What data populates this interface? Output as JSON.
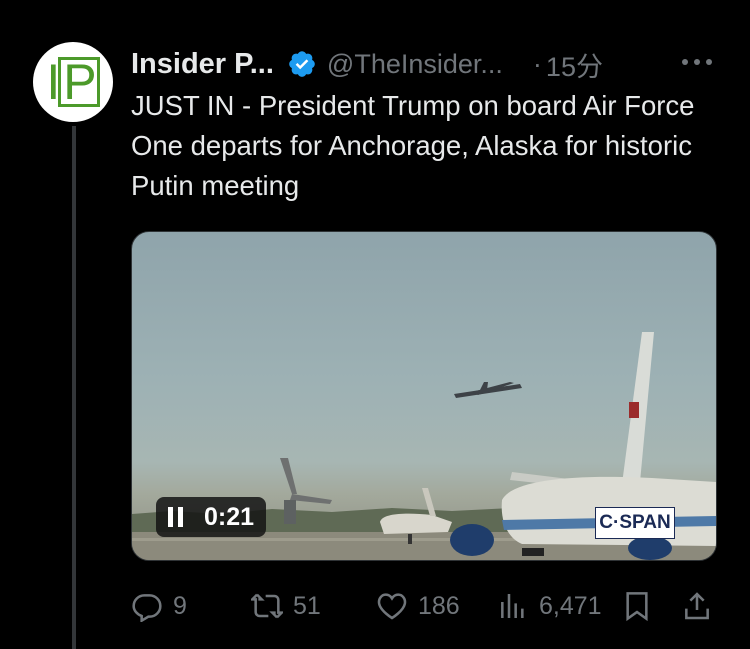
{
  "tweet": {
    "author_name": "Insider P...",
    "handle": "@TheInsider...",
    "separator": "·",
    "time": "15分",
    "text": "JUST IN - President Trump on board Air Force One departs for Anchorage, Alaska for historic Putin meeting",
    "avatar_text": "IP"
  },
  "media": {
    "duration": "0:21",
    "watermark": "C·SPAN"
  },
  "actions": {
    "replies": "9",
    "retweets": "51",
    "likes": "186",
    "views": "6,471"
  },
  "colors": {
    "background": "#000000",
    "text": "#e7e9ea",
    "muted": "#71767b",
    "verified": "#1d9bf0",
    "avatar_green": "#4c9a2a"
  }
}
